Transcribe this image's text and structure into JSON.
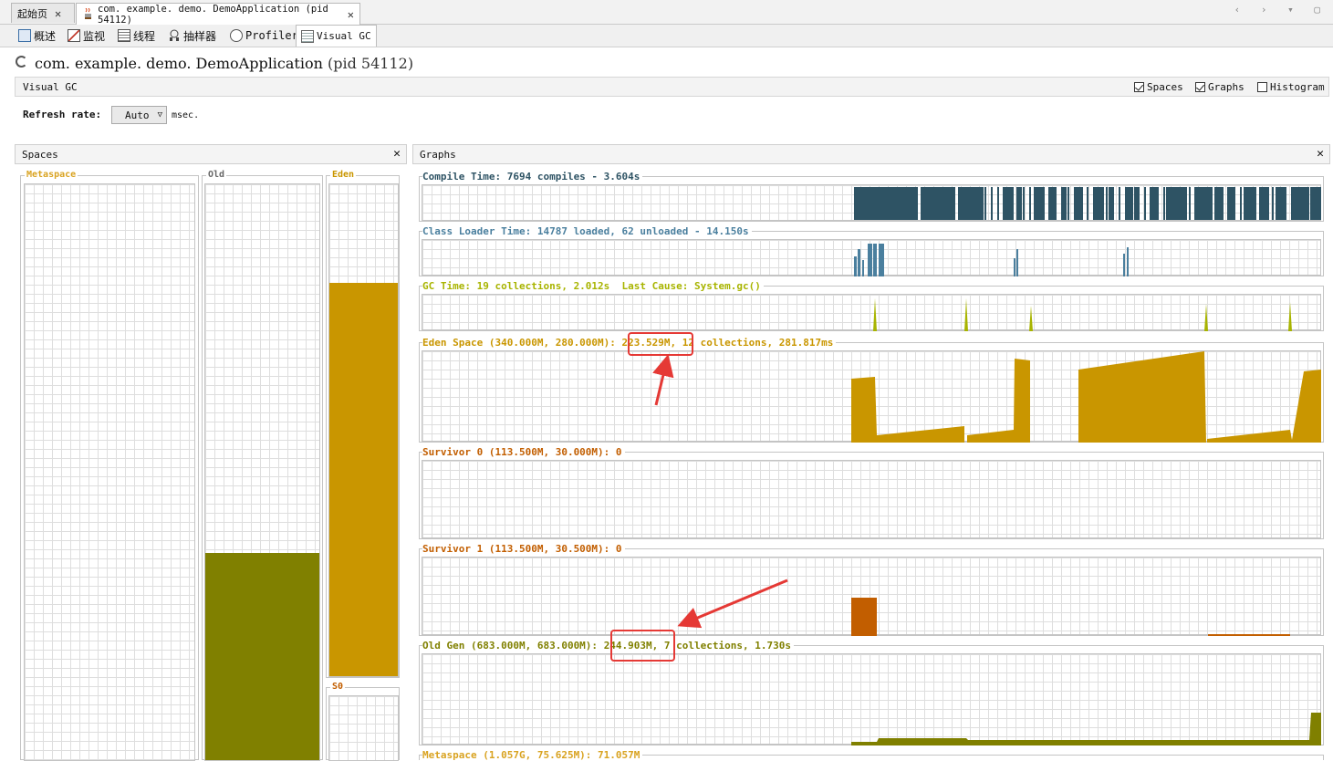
{
  "tabs": [
    {
      "label": "起始页",
      "close": "✕"
    },
    {
      "label": "com. example. demo. DemoApplication (pid 54112)",
      "close": "✕"
    }
  ],
  "subtabs": [
    {
      "label": "概述",
      "icon": "overview-icon"
    },
    {
      "label": "监视",
      "icon": "monitor-icon"
    },
    {
      "label": "线程",
      "icon": "threads-icon"
    },
    {
      "label": "抽样器",
      "icon": "sampler-icon"
    },
    {
      "label": "Profiler",
      "icon": "profiler-icon"
    },
    {
      "label": "Visual GC",
      "icon": "visualgc-icon"
    }
  ],
  "header": {
    "app_name": "com. example. demo. DemoApplication",
    "pid": "(pid 54112)"
  },
  "visual_gc": {
    "title": "Visual GC",
    "options": [
      {
        "label": "Spaces",
        "checked": true
      },
      {
        "label": "Graphs",
        "checked": true
      },
      {
        "label": "Histogram",
        "checked": false
      }
    ],
    "refresh_label": "Refresh rate:",
    "refresh_value": "Auto",
    "refresh_unit": "msec."
  },
  "spaces_panel": {
    "title": "Spaces",
    "close": "✕",
    "metaspace": {
      "label": "Metaspace",
      "fill": 0.0,
      "color": "#d9a321"
    },
    "old": {
      "label": "Old",
      "fill": 0.36,
      "color": "#808000"
    },
    "eden": {
      "label": "Eden",
      "fill": 0.8,
      "color": "#c99600"
    },
    "s0": {
      "label": "S0"
    }
  },
  "graphs_panel": {
    "title": "Graphs",
    "close": "✕",
    "graphs": [
      {
        "id": "compile",
        "label": "Compile Time: 7694 compiles - 3.604s",
        "color": "#2e5364"
      },
      {
        "id": "classloader",
        "label": "Class Loader Time: 14787 loaded, 62 unloaded - 14.150s",
        "color": "#4a7f9e"
      },
      {
        "id": "gc",
        "label": "GC Time: 19 collections, 2.012s  Last Cause: System.gc()",
        "color": "#a8b400"
      },
      {
        "id": "eden",
        "label_a": "Eden Space (340.000M, 280.000M):",
        "label_b": "223.529M,",
        "label_c": " 12 collections, 281.817ms",
        "color": "#c99600"
      },
      {
        "id": "s0",
        "label": "Survivor 0 (113.500M, 30.000M): 0",
        "color": "#c25e00"
      },
      {
        "id": "s1",
        "label": "Survivor 1 (113.500M, 30.500M): 0",
        "color": "#c25e00"
      },
      {
        "id": "old",
        "label_a": "Old Gen (683.000M, 683.000M):",
        "label_b": "244.903M,",
        "label_c": " 7 collections, 1.730s",
        "color": "#808000"
      },
      {
        "id": "meta",
        "label": "Metaspace (1.057G, 75.625M): 71.057M",
        "color": "#d9a321"
      }
    ]
  }
}
